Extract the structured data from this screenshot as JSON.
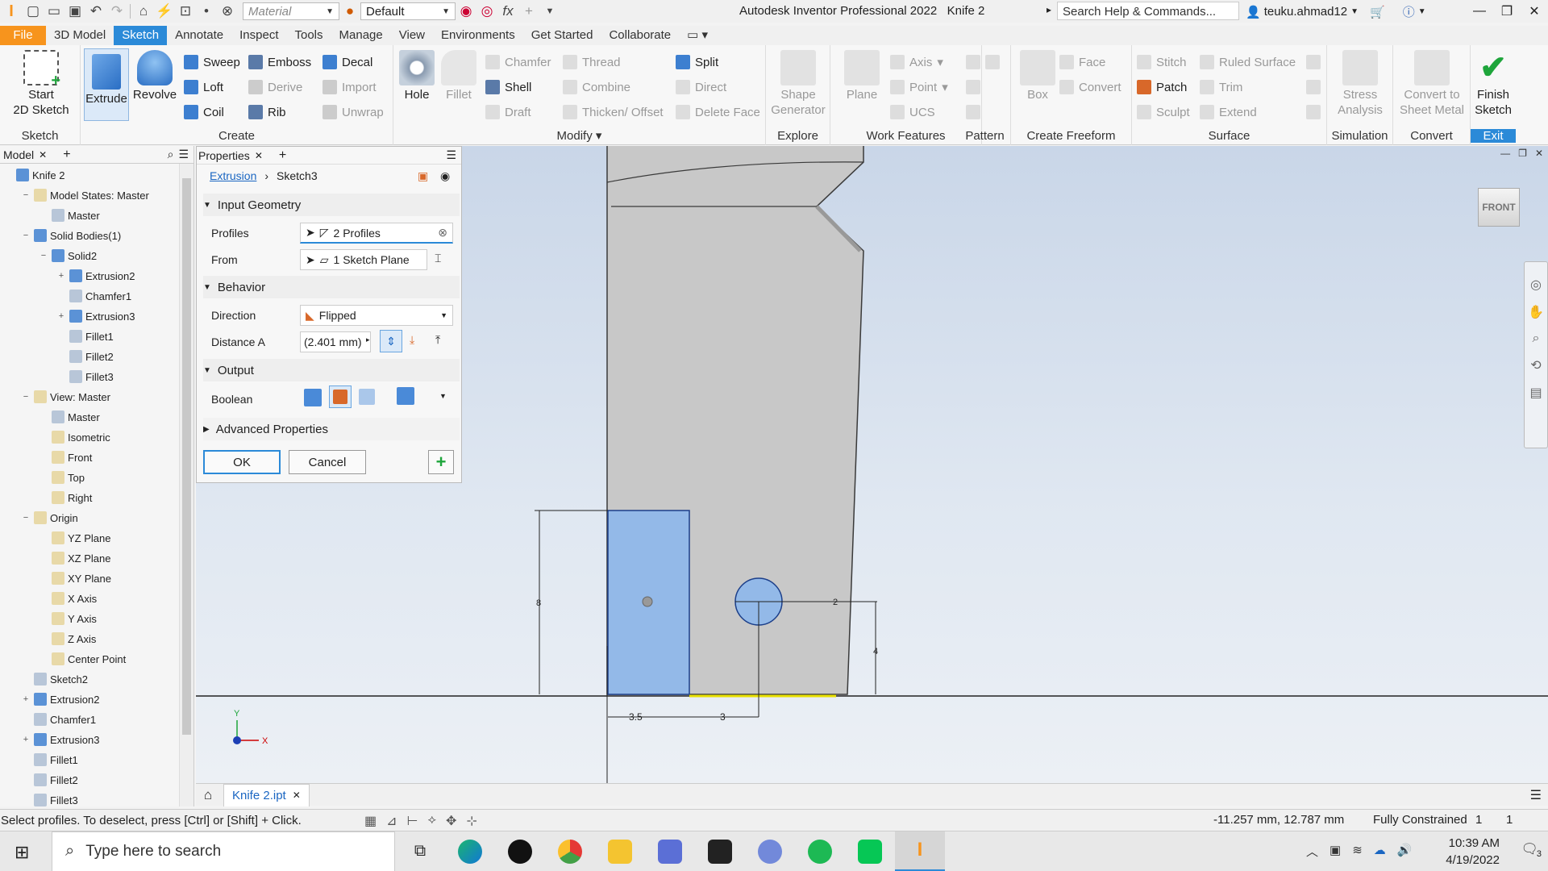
{
  "titlebar": {
    "material_combo": "Material",
    "appearance_combo": "Default",
    "app_title": "Autodesk Inventor Professional 2022",
    "doc_title": "Knife 2",
    "search_placeholder": "Search Help & Commands...",
    "username": "teuku.ahmad12"
  },
  "ribbon_tabs": [
    "File",
    "3D Model",
    "Sketch",
    "Annotate",
    "Inspect",
    "Tools",
    "Manage",
    "View",
    "Environments",
    "Get Started",
    "Collaborate"
  ],
  "ribbon": {
    "sketch_group": {
      "label": "Sketch",
      "start_sketch": "Start\n2D Sketch"
    },
    "create_group": {
      "label": "Create",
      "extrude": "Extrude",
      "revolve": "Revolve",
      "sweep": "Sweep",
      "loft": "Loft",
      "coil": "Coil",
      "emboss": "Emboss",
      "derive": "Derive",
      "rib": "Rib",
      "decal": "Decal",
      "import": "Import",
      "unwrap": "Unwrap"
    },
    "modify_group": {
      "label": "Modify",
      "hole": "Hole",
      "fillet": "Fillet",
      "chamfer": "Chamfer",
      "shell": "Shell",
      "draft": "Draft",
      "thread": "Thread",
      "combine": "Combine",
      "thicken": "Thicken/ Offset",
      "split": "Split",
      "direct": "Direct",
      "delete_face": "Delete Face"
    },
    "explore_group": {
      "label": "Explore",
      "shape_generator": "Shape\nGenerator"
    },
    "work_group": {
      "label": "Work Features",
      "plane": "Plane",
      "axis": "Axis",
      "point": "Point",
      "ucs": "UCS"
    },
    "pattern_group": {
      "label": "Pattern"
    },
    "freeform_group": {
      "label": "Create Freeform",
      "box": "Box",
      "face": "Face",
      "convert": "Convert"
    },
    "surface_group": {
      "label": "Surface",
      "stitch": "Stitch",
      "patch": "Patch",
      "sculpt": "Sculpt",
      "ruled_surface": "Ruled Surface",
      "trim": "Trim",
      "extend": "Extend"
    },
    "simulation_group": {
      "label": "Simulation",
      "stress": "Stress\nAnalysis"
    },
    "convert_group": {
      "label": "Convert",
      "sheet_metal": "Convert to\nSheet Metal"
    },
    "exit_group": {
      "label": "Exit",
      "finish": "Finish\nSketch"
    }
  },
  "browser": {
    "tab": "Model",
    "items": [
      {
        "label": "Knife 2",
        "indent": 0,
        "exp": ""
      },
      {
        "label": "Model States: Master",
        "indent": 1,
        "exp": "−"
      },
      {
        "label": "Master",
        "indent": 2,
        "exp": ""
      },
      {
        "label": "Solid Bodies(1)",
        "indent": 1,
        "exp": "−"
      },
      {
        "label": "Solid2",
        "indent": 2,
        "exp": "−"
      },
      {
        "label": "Extrusion2",
        "indent": 3,
        "exp": "+"
      },
      {
        "label": "Chamfer1",
        "indent": 3,
        "exp": ""
      },
      {
        "label": "Extrusion3",
        "indent": 3,
        "exp": "+"
      },
      {
        "label": "Fillet1",
        "indent": 3,
        "exp": ""
      },
      {
        "label": "Fillet2",
        "indent": 3,
        "exp": ""
      },
      {
        "label": "Fillet3",
        "indent": 3,
        "exp": ""
      },
      {
        "label": "View: Master",
        "indent": 1,
        "exp": "−"
      },
      {
        "label": "Master",
        "indent": 2,
        "exp": ""
      },
      {
        "label": "Isometric",
        "indent": 2,
        "exp": ""
      },
      {
        "label": "Front",
        "indent": 2,
        "exp": ""
      },
      {
        "label": "Top",
        "indent": 2,
        "exp": ""
      },
      {
        "label": "Right",
        "indent": 2,
        "exp": ""
      },
      {
        "label": "Origin",
        "indent": 1,
        "exp": "−"
      },
      {
        "label": "YZ Plane",
        "indent": 2,
        "exp": ""
      },
      {
        "label": "XZ Plane",
        "indent": 2,
        "exp": ""
      },
      {
        "label": "XY Plane",
        "indent": 2,
        "exp": ""
      },
      {
        "label": "X Axis",
        "indent": 2,
        "exp": ""
      },
      {
        "label": "Y Axis",
        "indent": 2,
        "exp": ""
      },
      {
        "label": "Z Axis",
        "indent": 2,
        "exp": ""
      },
      {
        "label": "Center Point",
        "indent": 2,
        "exp": ""
      },
      {
        "label": "Sketch2",
        "indent": 1,
        "exp": ""
      },
      {
        "label": "Extrusion2",
        "indent": 1,
        "exp": "+"
      },
      {
        "label": "Chamfer1",
        "indent": 1,
        "exp": ""
      },
      {
        "label": "Extrusion3",
        "indent": 1,
        "exp": "+"
      },
      {
        "label": "Fillet1",
        "indent": 1,
        "exp": ""
      },
      {
        "label": "Fillet2",
        "indent": 1,
        "exp": ""
      },
      {
        "label": "Fillet3",
        "indent": 1,
        "exp": ""
      }
    ]
  },
  "properties": {
    "tab": "Properties",
    "breadcrumb_feature": "Extrusion",
    "breadcrumb_sketch": "Sketch3",
    "input_geometry": "Input Geometry",
    "profiles_label": "Profiles",
    "profiles_value": "2 Profiles",
    "from_label": "From",
    "from_value": "1 Sketch Plane",
    "behavior": "Behavior",
    "direction_label": "Direction",
    "direction_value": "Flipped",
    "distance_label": "Distance A",
    "distance_value": "(2.401 mm)",
    "output": "Output",
    "boolean_label": "Boolean",
    "advanced": "Advanced Properties",
    "ok": "OK",
    "cancel": "Cancel"
  },
  "viewport": {
    "viewcube_label": "FRONT",
    "dims": {
      "height": "8",
      "width1": "3.5",
      "width2": "3",
      "circle": "2",
      "offset": "4"
    },
    "axis_x": "X",
    "axis_y": "Y"
  },
  "doc_tab": "Knife 2.ipt",
  "status": {
    "message": "Select profiles. To deselect, press [Ctrl] or [Shift] + Click.",
    "coords": "-11.257 mm, 12.787 mm",
    "constraint": "Fully Constrained",
    "count1": "1",
    "count2": "1"
  },
  "taskbar": {
    "search_placeholder": "Type here to search",
    "time": "10:39 AM",
    "date": "4/19/2022",
    "notifications": "3"
  },
  "colors": {
    "accent": "#2b8ad8",
    "file_tab": "#f7941d",
    "profile_fill": "#93b9e8",
    "part_gray": "#c8c8c8",
    "finish_green": "#1ea53b"
  }
}
